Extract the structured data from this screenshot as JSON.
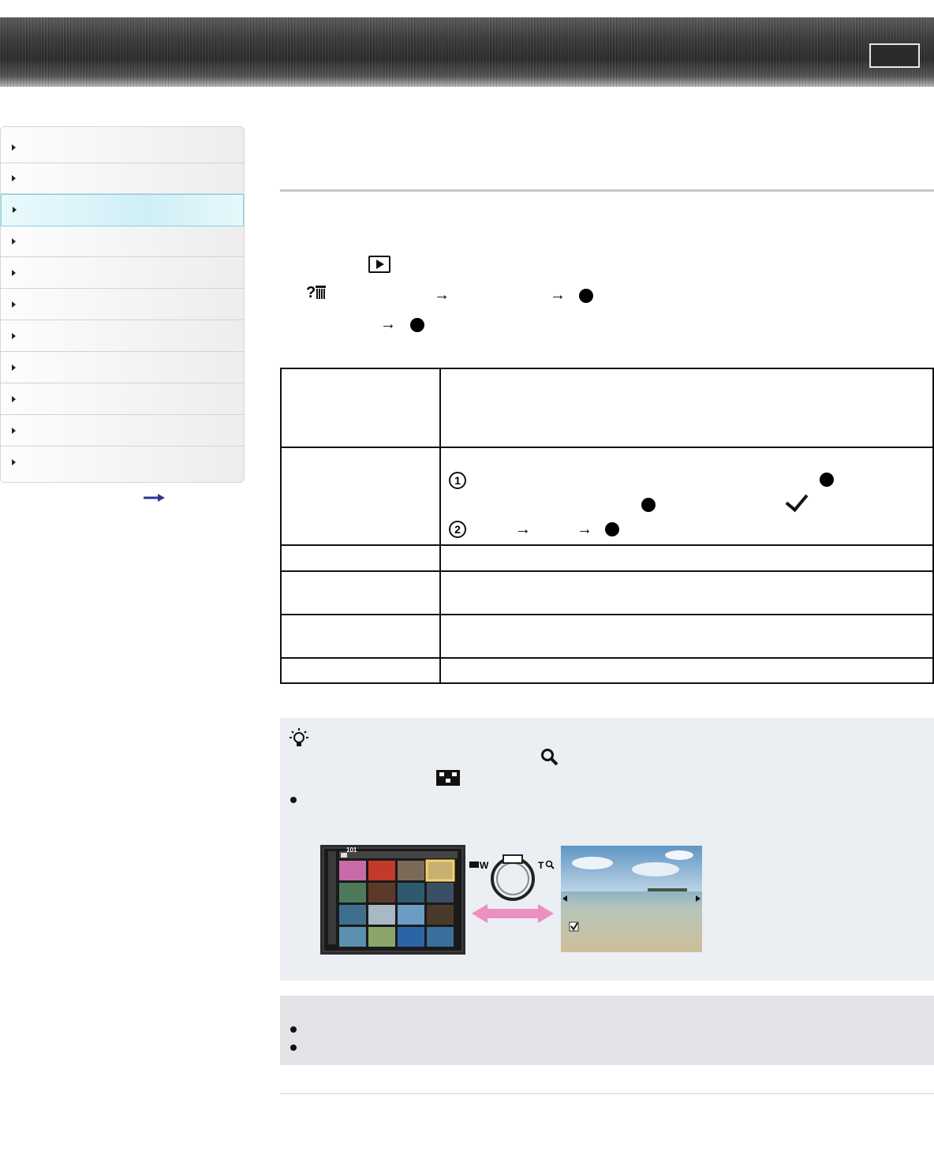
{
  "header": {
    "title": "",
    "top_button_label": ""
  },
  "sidebar": {
    "items": [
      {
        "label": ""
      },
      {
        "label": ""
      },
      {
        "label": "",
        "active": true
      },
      {
        "label": ""
      },
      {
        "label": ""
      },
      {
        "label": ""
      },
      {
        "label": ""
      },
      {
        "label": ""
      },
      {
        "label": ""
      },
      {
        "label": ""
      },
      {
        "label": ""
      }
    ],
    "more_link": ""
  },
  "content": {
    "page_title": "",
    "table_rows": [
      {
        "label": "",
        "desc": ""
      },
      {
        "label": "",
        "desc": ""
      },
      {
        "label": "",
        "desc": ""
      },
      {
        "label": "",
        "desc": ""
      },
      {
        "label": "",
        "desc": ""
      },
      {
        "label": "",
        "desc": ""
      }
    ],
    "hint": {
      "lcd_folder": "101",
      "wheel_left": "W",
      "wheel_right": "T"
    }
  },
  "icons": [
    "play-icon",
    "help-icon",
    "trash-icon",
    "arrow-icon",
    "center-button-icon",
    "check-icon",
    "circled-1-icon",
    "circled-2-icon",
    "hint-bulb-icon",
    "zoom-icon",
    "index-icon",
    "arrow-right-icon"
  ]
}
